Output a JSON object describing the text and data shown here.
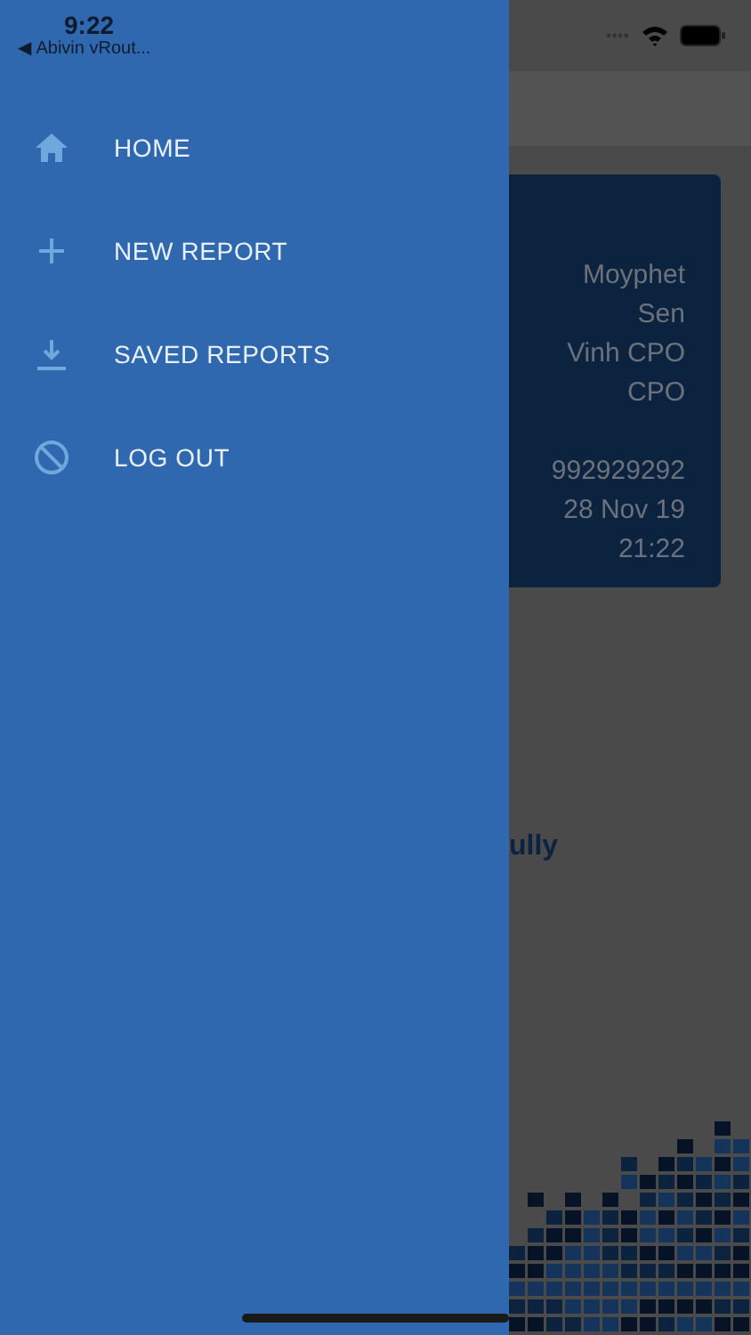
{
  "status_bar": {
    "time": "9:22",
    "back_label": "◀ Abivin vRout..."
  },
  "drawer": {
    "items": [
      {
        "label": "HOME",
        "kind": "home"
      },
      {
        "label": "NEW REPORT",
        "kind": "plus"
      },
      {
        "label": "SAVED REPORTS",
        "kind": "download"
      },
      {
        "label": "LOG OUT",
        "kind": "block"
      }
    ]
  },
  "background": {
    "card": {
      "groups": [
        [
          "Moyphet",
          "Sen",
          "Vinh CPO",
          "CPO"
        ],
        [
          "992929292",
          "28 Nov 19",
          "21:22"
        ]
      ]
    },
    "message": "ully"
  }
}
